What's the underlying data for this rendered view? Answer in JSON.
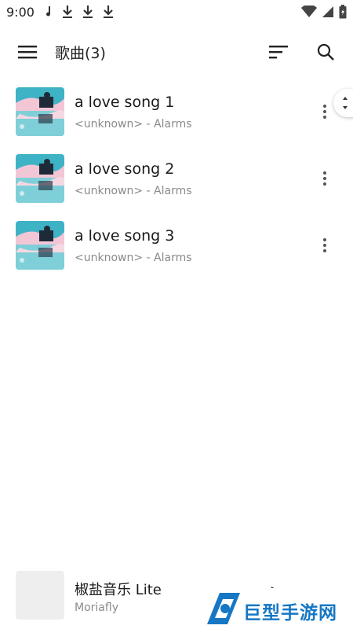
{
  "status": {
    "time": "9:00",
    "icons_left": [
      "music-note-icon",
      "download-icon",
      "download-icon",
      "download-icon"
    ],
    "icons_right": [
      "wifi-icon",
      "signal-icon",
      "battery-icon"
    ]
  },
  "app_bar": {
    "title": "歌曲(3)",
    "menu_icon": "hamburger-menu-icon",
    "sort_icon": "sort-icon",
    "search_icon": "search-icon"
  },
  "songs": [
    {
      "title": "a love song 1",
      "subtitle": "<unknown> - Alarms"
    },
    {
      "title": "a love song 2",
      "subtitle": "<unknown> - Alarms"
    },
    {
      "title": "a love song 3",
      "subtitle": "<unknown> - Alarms"
    }
  ],
  "player": {
    "title": "椒盐音乐 Lite",
    "subtitle": "Moriafly"
  },
  "watermark": {
    "text": "巨型手游网"
  },
  "colors": {
    "accent": "#1677c4",
    "secondary_text": "#8a8a8a"
  }
}
